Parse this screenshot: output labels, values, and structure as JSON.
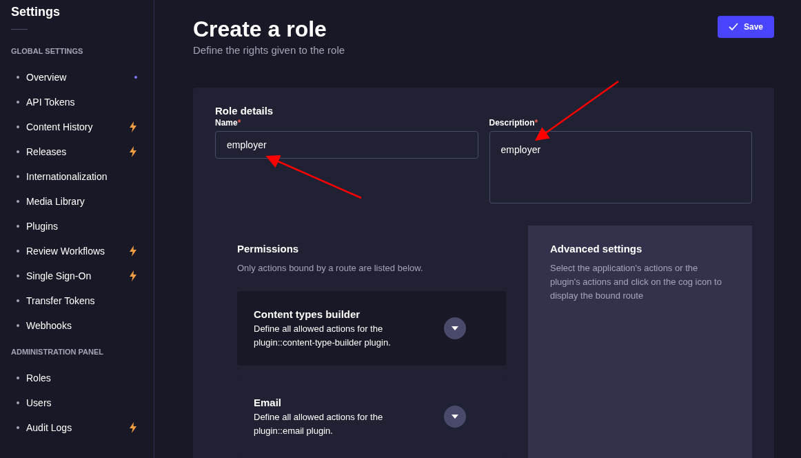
{
  "sidebar": {
    "title": "Settings",
    "sections": [
      {
        "heading": "GLOBAL SETTINGS",
        "items": [
          {
            "label": "Overview",
            "new": true,
            "premium": false
          },
          {
            "label": "API Tokens",
            "new": false,
            "premium": false
          },
          {
            "label": "Content History",
            "new": false,
            "premium": true
          },
          {
            "label": "Releases",
            "new": false,
            "premium": true
          },
          {
            "label": "Internationalization",
            "new": false,
            "premium": false
          },
          {
            "label": "Media Library",
            "new": false,
            "premium": false
          },
          {
            "label": "Plugins",
            "new": false,
            "premium": false
          },
          {
            "label": "Review Workflows",
            "new": false,
            "premium": true
          },
          {
            "label": "Single Sign-On",
            "new": false,
            "premium": true
          },
          {
            "label": "Transfer Tokens",
            "new": false,
            "premium": false
          },
          {
            "label": "Webhooks",
            "new": false,
            "premium": false
          }
        ]
      },
      {
        "heading": "ADMINISTRATION PANEL",
        "items": [
          {
            "label": "Roles",
            "new": false,
            "premium": false
          },
          {
            "label": "Users",
            "new": false,
            "premium": false
          },
          {
            "label": "Audit Logs",
            "new": false,
            "premium": true
          }
        ]
      }
    ]
  },
  "header": {
    "title": "Create a role",
    "subtitle": "Define the rights given to the role",
    "save_button": "Save"
  },
  "role_details": {
    "title": "Role details",
    "name": {
      "label": "Name",
      "required_mark": "*",
      "value": "employer"
    },
    "description": {
      "label": "Description",
      "required_mark": "*",
      "value": "employer"
    }
  },
  "permissions": {
    "title": "Permissions",
    "subtitle": "Only actions bound by a route are listed below.",
    "groups": [
      {
        "title": "Content types builder",
        "description": "Define all allowed actions for the plugin::content-type-builder plugin.",
        "shaded": true
      },
      {
        "title": "Email",
        "description": "Define all allowed actions for the plugin::email plugin.",
        "shaded": false
      }
    ]
  },
  "advanced": {
    "title": "Advanced settings",
    "text": "Select the application's actions or the plugin's actions and click on the cog icon to display the bound route"
  }
}
